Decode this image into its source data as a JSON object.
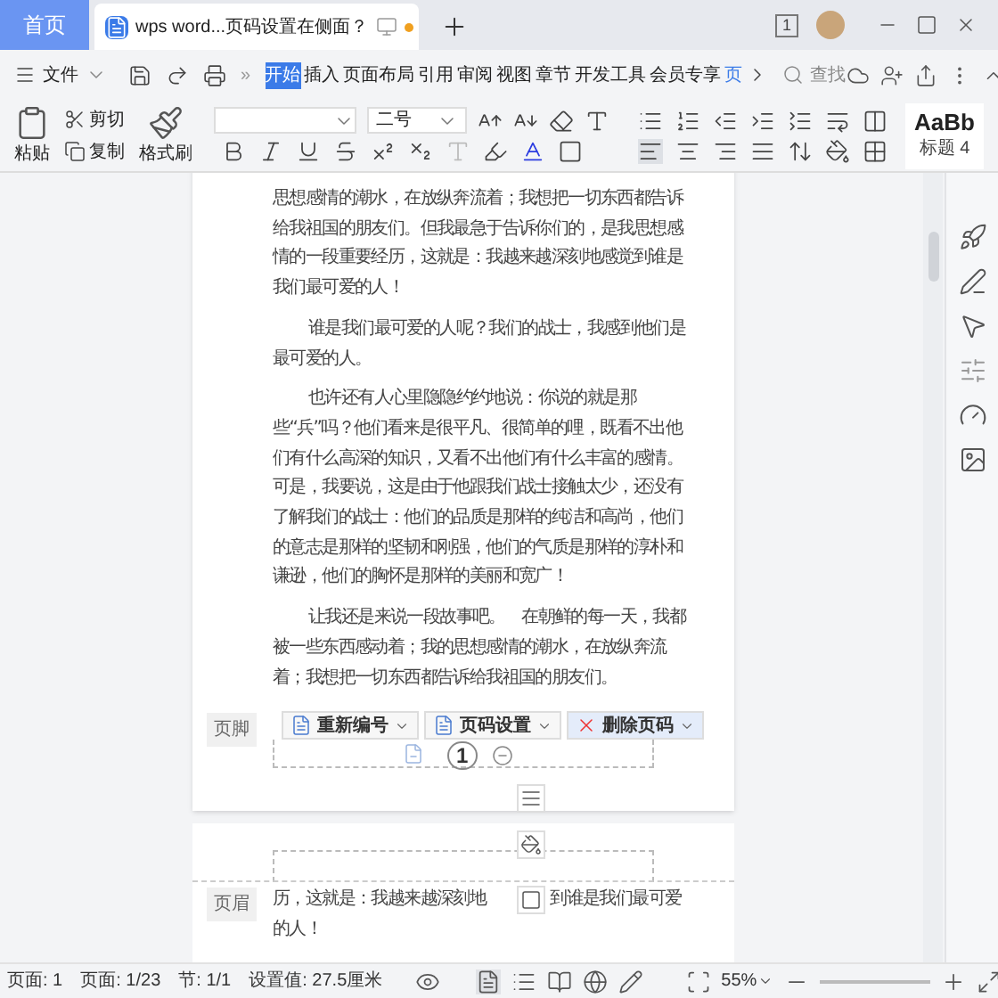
{
  "tabs": [
    {
      "label": "首页",
      "kind": "home",
      "selected": false
    },
    {
      "label": "wps word...页码设置在侧面？",
      "kind": "document",
      "selected": true
    }
  ],
  "window_badge": "1",
  "menu": {
    "file": "文件",
    "more": "»",
    "search": "查找",
    "ribbon_tabs": [
      {
        "label": "开始",
        "selected": true,
        "kind": "normal"
      },
      {
        "label": "插入",
        "selected": false,
        "kind": "normal"
      },
      {
        "label": "页面布局",
        "selected": false,
        "kind": "normal"
      },
      {
        "label": "引用",
        "selected": false,
        "kind": "normal"
      },
      {
        "label": "审阅",
        "selected": false,
        "kind": "normal"
      },
      {
        "label": "视图",
        "selected": false,
        "kind": "normal"
      },
      {
        "label": "章节",
        "selected": false,
        "kind": "normal"
      },
      {
        "label": "开发工具",
        "selected": false,
        "kind": "normal"
      },
      {
        "label": "会员专享",
        "selected": false,
        "kind": "normal"
      },
      {
        "label": "页",
        "selected": false,
        "kind": "contextual"
      }
    ]
  },
  "ribbon": {
    "paste": "粘贴",
    "cut": "剪切",
    "copy": "复制",
    "format_painter": "格式刷",
    "font_size": "二号",
    "style_preview": "AaBb",
    "style_name": "标题 4"
  },
  "page_one": {
    "paragraphs": [
      {
        "indent": false,
        "text": "思想感情的潮水，在放纵奔流着；我想把一切东西都告诉给我祖国的朋友们。但我最急于告诉你们的，是我思想感情的一段重要经历，这就是：我越来越深刻地感觉到谁是我们最可爱的人！"
      },
      {
        "indent": true,
        "text": "谁是我们最可爱的人呢？我们的战士，我感到他们是最可爱的人。"
      },
      {
        "indent": true,
        "text": "也许还有人心里隐隐约约地说：你说的就是那些“兵”吗？他们看来是很平凡、很简单的哩，既看不出他们有什么高深的知识，又看不出他们有什么丰富的感情。可是，我要说，这是由于他跟我们战士接触太少，还没有了解我们的战士：他们的品质是那样的纯洁和高尚，他们的意志是那样的坚韧和刚强，他们的气质是那样的淳朴和谦逊，他们的胸怀是那样的美丽和宽广！"
      },
      {
        "indent": true,
        "text": "让我还是来说一段故事吧。　在朝鲜的每一天，我都被一些东西感动着；我的思想感情的潮水，在放纵奔流着；我想把一切东西都告诉给我祖国的朋友们。"
      }
    ],
    "footer": {
      "label": "页脚",
      "buttons": [
        "重新编号",
        "页码设置",
        "删除页码"
      ],
      "page_number": "1"
    }
  },
  "page_two": {
    "header_label": "页眉",
    "line_start": "历，这就是：我越来越深刻地",
    "line_rest": "到谁是我们最可爱",
    "line_end": "的人！"
  },
  "status_bar": {
    "items": [
      "页面: 1",
      "页面: 1/23",
      "节: 1/1",
      "设置值: 27.5厘米"
    ],
    "zoom": "55%"
  }
}
